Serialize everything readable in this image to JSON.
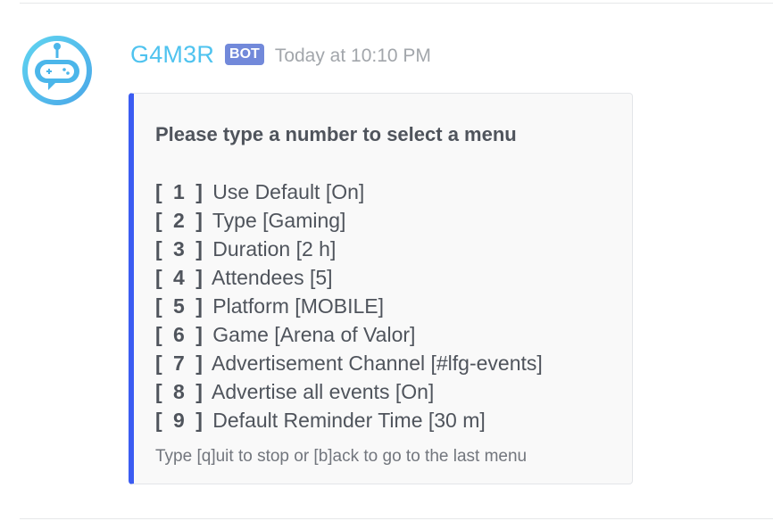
{
  "message": {
    "author": {
      "name": "G4M3R",
      "tag": "BOT",
      "avatar_icon": "gamepad-robot-icon"
    },
    "timestamp": "Today at 10:10 PM",
    "embed": {
      "accent_color": "#3b5cf2",
      "title": "Please type a number to select a menu",
      "items": [
        {
          "num": "[ 1 ]",
          "label": "Use Default [On]"
        },
        {
          "num": "[ 2 ]",
          "label": "Type [Gaming]"
        },
        {
          "num": "[ 3 ]",
          "label": "Duration [2 h]"
        },
        {
          "num": "[ 4 ]",
          "label": "Attendees [5]"
        },
        {
          "num": "[ 5 ]",
          "label": "Platform [MOBILE]"
        },
        {
          "num": "[ 6 ]",
          "label": "Game [Arena of Valor]"
        },
        {
          "num": "[ 7 ]",
          "label": "Advertisement Channel [#lfg-events]"
        },
        {
          "num": "[ 8 ]",
          "label": "Advertise all events [On]"
        },
        {
          "num": "[ 9 ]",
          "label": "Default Reminder Time [30 m]"
        }
      ],
      "footer": "Type [q]uit to stop or [b]ack to go to the last menu"
    }
  },
  "colors": {
    "username": "#4fc3ef",
    "bot_tag": "#7289da",
    "timestamp": "#a2a6ab",
    "text": "#4f545c"
  }
}
